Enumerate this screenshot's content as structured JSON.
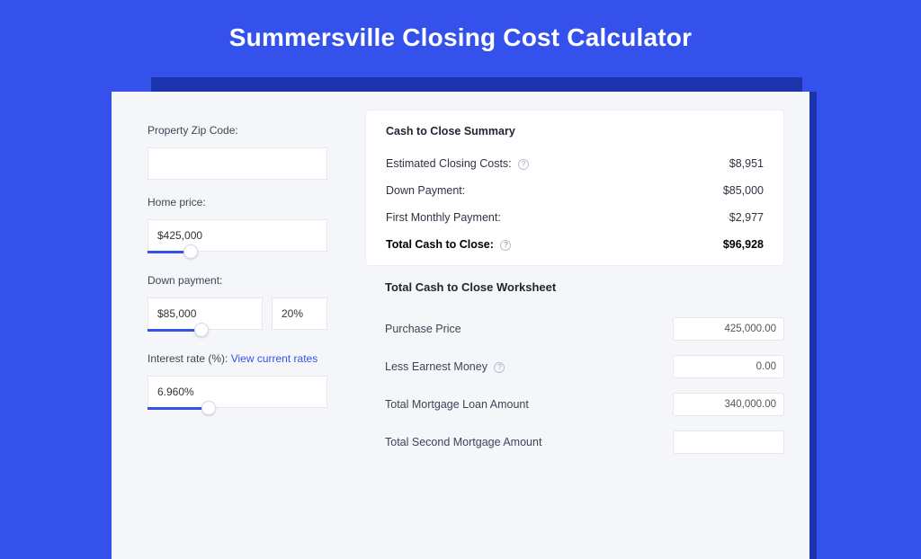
{
  "title": "Summersville Closing Cost Calculator",
  "left": {
    "zip_label": "Property Zip Code:",
    "zip_value": "",
    "price_label": "Home price:",
    "price_value": "$425,000",
    "down_label": "Down payment:",
    "down_value": "$85,000",
    "down_pct": "20%",
    "rate_label": "Interest rate (%):",
    "rate_link": "View current rates",
    "rate_value": "6.960%"
  },
  "summary": {
    "title": "Cash to Close Summary",
    "rows": [
      {
        "label": "Estimated Closing Costs:",
        "help": true,
        "value": "$8,951"
      },
      {
        "label": "Down Payment:",
        "help": false,
        "value": "$85,000"
      },
      {
        "label": "First Monthly Payment:",
        "help": false,
        "value": "$2,977"
      }
    ],
    "total_label": "Total Cash to Close:",
    "total_value": "$96,928"
  },
  "worksheet": {
    "title": "Total Cash to Close Worksheet",
    "rows": [
      {
        "label": "Purchase Price",
        "help": false,
        "value": "425,000.00"
      },
      {
        "label": "Less Earnest Money",
        "help": true,
        "value": "0.00"
      },
      {
        "label": "Total Mortgage Loan Amount",
        "help": false,
        "value": "340,000.00"
      },
      {
        "label": "Total Second Mortgage Amount",
        "help": false,
        "value": ""
      }
    ]
  },
  "slider": {
    "price_track_pct": 24,
    "down_track_pct": 30,
    "rate_track_pct": 34
  }
}
